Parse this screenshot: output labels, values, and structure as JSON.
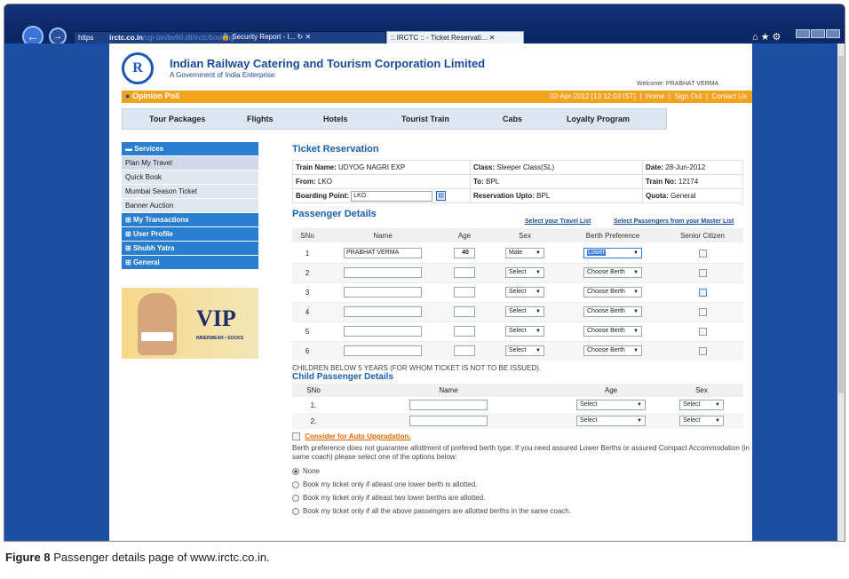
{
  "browser": {
    "address_prefix": "https",
    "address_host": "irctc.co.in",
    "address_rest": "/cgi-bin/bv60.dll/irctc/booking",
    "tab_security": "Security Report - I...",
    "tab_active": ":: IRCTC :: - Ticket Reservati..."
  },
  "header": {
    "logo_text": "R",
    "title": "Indian Railway Catering and Tourism Corporation Limited",
    "subtitle": "A Government of India Enterprise",
    "welcome": "Welcome: PRABHAT VERMA"
  },
  "orange_bar": {
    "opinion": "Opinion Poll",
    "datetime": "02-Apr-2012 [13:12:03 IST]",
    "links": [
      "Home",
      "Sign Out",
      "Contact Us"
    ]
  },
  "menu": [
    "Tour Packages",
    "Flights",
    "Hotels",
    "Tourist Train",
    "Cabs",
    "Loyalty Program"
  ],
  "sidebar": {
    "services": "Services",
    "service_items": [
      "Plan My Travel",
      "Quick Book",
      "Mumbai Season Ticket",
      "Banner Auction"
    ],
    "groups": [
      "My Transactions",
      "User Profile",
      "Shubh Yatra",
      "General"
    ]
  },
  "ad": {
    "brand": "VIP",
    "tag": "INNERWEAR • SOCKS"
  },
  "reservation": {
    "title": "Ticket Reservation",
    "train_name_label": "Train Name:",
    "train_name": "UDYOG NAGRI EXP",
    "class_label": "Class:",
    "class": "Sleeper Class(SL)",
    "date_label": "Date:",
    "date": "28-Jun-2012",
    "from_label": "From:",
    "from": "LKO",
    "to_label": "To:",
    "to": "BPL",
    "train_no_label": "Train No:",
    "train_no": "12174",
    "boarding_label": "Boarding Point:",
    "boarding": "LKO",
    "upto_label": "Reservation Upto:",
    "upto": "BPL",
    "quota_label": "Quota:",
    "quota": "General"
  },
  "passengers": {
    "title": "Passenger Details",
    "travel_list_link": "Select your Travel List",
    "master_list_link": "Select Passengers from your Master List",
    "headers": [
      "SNo",
      "Name",
      "Age",
      "Sex",
      "Berth Preference",
      "Senior Citizen"
    ],
    "rows": [
      {
        "sno": "1",
        "name": "PRABHAT VERMA",
        "age": "40",
        "sex": "Male",
        "berth": "Lower"
      },
      {
        "sno": "2",
        "name": "",
        "age": "",
        "sex": "Select",
        "berth": "Choose Berth"
      },
      {
        "sno": "3",
        "name": "",
        "age": "",
        "sex": "Select",
        "berth": "Choose Berth"
      },
      {
        "sno": "4",
        "name": "",
        "age": "",
        "sex": "Select",
        "berth": "Choose Berth"
      },
      {
        "sno": "5",
        "name": "",
        "age": "",
        "sex": "Select",
        "berth": "Choose Berth"
      },
      {
        "sno": "6",
        "name": "",
        "age": "",
        "sex": "Select",
        "berth": "Choose Berth"
      }
    ]
  },
  "children": {
    "note": "CHILDREN BELOW 5 YEARS (FOR WHOM TICKET IS NOT TO BE ISSUED).",
    "title": "Child Passenger Details",
    "headers": [
      "SNo",
      "Name",
      "Age",
      "Sex"
    ],
    "rows": [
      {
        "sno": "1.",
        "age": "Select",
        "sex": "Select"
      },
      {
        "sno": "2.",
        "age": "Select",
        "sex": "Select"
      }
    ]
  },
  "upgrade": {
    "label": "Consider for Auto Upgradation.",
    "berth_note": "Berth preference does not guarantee allottment of prefered berth type. If you need assured Lower Berths or assured Compact Accommodation (in same coach) please select one of the options below:",
    "options": [
      "None",
      "Book my ticket only if atleast one lower berth is allotted.",
      "Book my ticket only if atleast two lower berths are allotted.",
      "Book my ticket only if all the above passengers are allotted berths in the same coach."
    ]
  },
  "caption": {
    "figure": "Figure 8",
    "text": "Passenger details page of www.irctc.co.in."
  }
}
